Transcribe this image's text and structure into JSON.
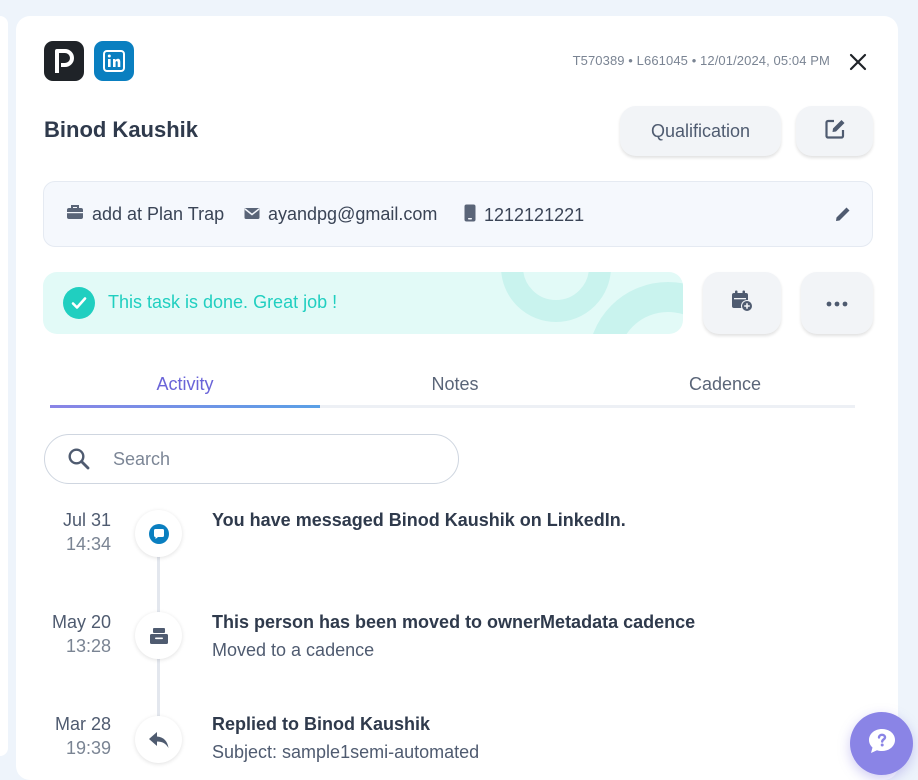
{
  "header": {
    "meta": "T570389 • L661045 • 12/01/2024, 05:04 PM",
    "name": "Binod Kaushik",
    "qualification_label": "Qualification"
  },
  "contact": {
    "company": "add at Plan Trap",
    "email": "ayandpg@gmail.com",
    "phone": "1212121221"
  },
  "status": {
    "message": "This task is done. Great job !"
  },
  "tabs": [
    {
      "label": "Activity",
      "active": true
    },
    {
      "label": "Notes",
      "active": false
    },
    {
      "label": "Cadence",
      "active": false
    }
  ],
  "search": {
    "placeholder": "Search"
  },
  "activities": [
    {
      "date": "Jul 31",
      "time": "14:34",
      "title": "You have messaged Binod Kaushik on LinkedIn.",
      "subtitle": "",
      "icon": "linkedin-message-icon"
    },
    {
      "date": "May 20",
      "time": "13:28",
      "title": "This person has been moved to ownerMetadata cadence",
      "subtitle": "Moved to a cadence",
      "icon": "cadence-icon"
    },
    {
      "date": "Mar 28",
      "time": "19:39",
      "title": "Replied to Binod Kaushik",
      "subtitle": "Subject: sample1semi-automated",
      "icon": "reply-icon"
    }
  ],
  "colors": {
    "accent": "#6a64d8",
    "success": "#20cfc0",
    "linkedin": "#0a7fc0"
  }
}
